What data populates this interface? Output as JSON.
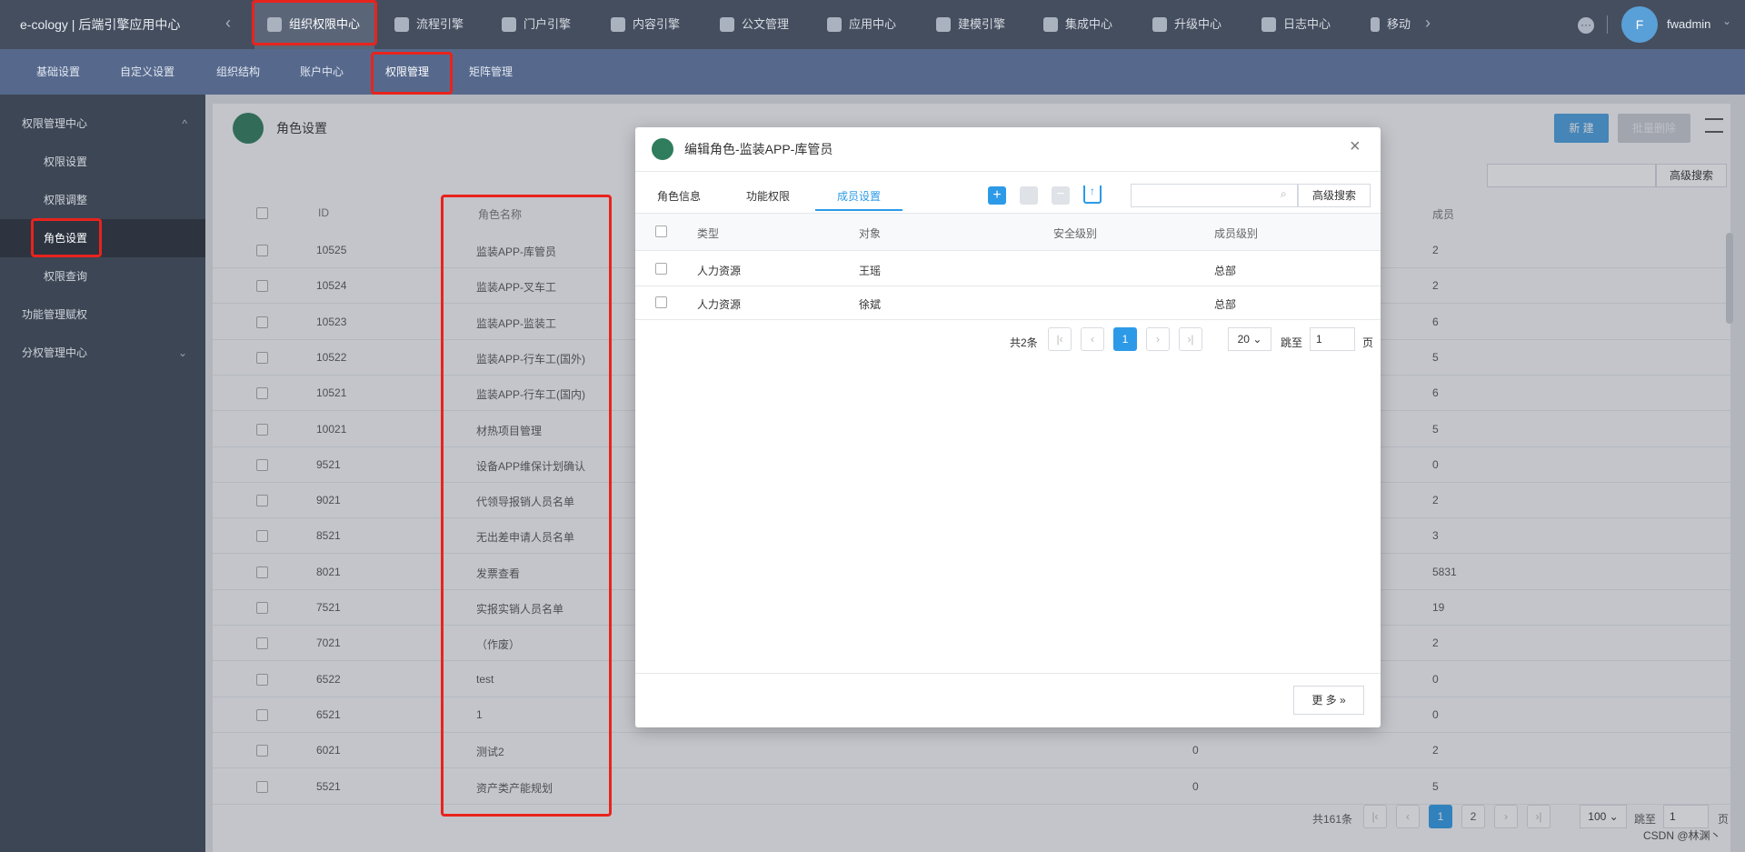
{
  "app": {
    "title": "e-cology | 后端引擎应用中心",
    "user": "fwadmin",
    "avatar_letter": "F",
    "watermark": "CSDN @林渊丶"
  },
  "topnav": [
    {
      "label": "组织权限中心",
      "icon": "shield-icon"
    },
    {
      "label": "流程引擎",
      "icon": "flow-icon"
    },
    {
      "label": "门户引擎",
      "icon": "portal-icon"
    },
    {
      "label": "内容引擎",
      "icon": "document-icon"
    },
    {
      "label": "公文管理",
      "icon": "file-icon"
    },
    {
      "label": "应用中心",
      "icon": "grid-icon"
    },
    {
      "label": "建模引擎",
      "icon": "cube-icon"
    },
    {
      "label": "集成中心",
      "icon": "snowflake-icon"
    },
    {
      "label": "升级中心",
      "icon": "upgrade-icon"
    },
    {
      "label": "日志中心",
      "icon": "log-icon"
    },
    {
      "label": "移动",
      "icon": "mobile-icon"
    }
  ],
  "subnav": [
    "基础设置",
    "自定义设置",
    "组织结构",
    "账户中心",
    "权限管理",
    "矩阵管理"
  ],
  "sidebar": {
    "group1": "权限管理中心",
    "items": [
      "权限设置",
      "权限调整",
      "角色设置",
      "权限查询"
    ],
    "group2": "功能管理赋权",
    "group3": "分权管理中心"
  },
  "page": {
    "title": "角色设置",
    "new_button": "新 建",
    "batch_delete": "批量删除",
    "advanced_search": "高级搜索",
    "headers": {
      "id": "ID",
      "name": "角色名称",
      "members": "成员"
    },
    "rows": [
      {
        "id": "10525",
        "name": "监装APP-库管员",
        "level": "",
        "members": "2"
      },
      {
        "id": "10524",
        "name": "监装APP-叉车工",
        "level": "",
        "members": "2"
      },
      {
        "id": "10523",
        "name": "监装APP-监装工",
        "level": "",
        "members": "6"
      },
      {
        "id": "10522",
        "name": "监装APP-行车工(国外)",
        "level": "",
        "members": "5"
      },
      {
        "id": "10521",
        "name": "监装APP-行车工(国内)",
        "level": "",
        "members": "6"
      },
      {
        "id": "10021",
        "name": "材热项目管理",
        "level": "",
        "members": "5"
      },
      {
        "id": "9521",
        "name": "设备APP维保计划确认",
        "level": "",
        "members": "0"
      },
      {
        "id": "9021",
        "name": "代领导报销人员名单",
        "level": "",
        "members": "2"
      },
      {
        "id": "8521",
        "name": "无出差申请人员名单",
        "level": "",
        "members": "3"
      },
      {
        "id": "8021",
        "name": "发票查看",
        "level": "",
        "members": "5831"
      },
      {
        "id": "7521",
        "name": "实报实销人员名单",
        "level": "",
        "members": "19"
      },
      {
        "id": "7021",
        "name": "（作废）",
        "level": "",
        "members": "2"
      },
      {
        "id": "6522",
        "name": "test",
        "level": "",
        "members": "0"
      },
      {
        "id": "6521",
        "name": "1",
        "level": "",
        "members": "0"
      },
      {
        "id": "6021",
        "name": "测试2",
        "level": "0",
        "members": "2"
      },
      {
        "id": "5521",
        "name": "资产类产能规划",
        "level": "0",
        "members": "5"
      }
    ],
    "pager": {
      "total": "共161条",
      "pages": [
        "1",
        "2"
      ],
      "size": "100",
      "jump_label": "跳至",
      "jump_value": "1",
      "page_unit": "页"
    }
  },
  "modal": {
    "title": "编辑角色-监装APP-库管员",
    "tabs": [
      "角色信息",
      "功能权限",
      "成员设置"
    ],
    "advanced_search": "高级搜索",
    "headers": [
      "类型",
      "对象",
      "安全级别",
      "成员级别"
    ],
    "rows": [
      {
        "type": "人力资源",
        "object": "王瑶",
        "security": "",
        "level": "总部"
      },
      {
        "type": "人力资源",
        "object": "徐斌",
        "security": "",
        "level": "总部"
      }
    ],
    "pager": {
      "total": "共2条",
      "current": "1",
      "size": "20",
      "jump_label": "跳至",
      "jump_value": "1",
      "page_unit": "页"
    },
    "more_button": "更 多"
  }
}
